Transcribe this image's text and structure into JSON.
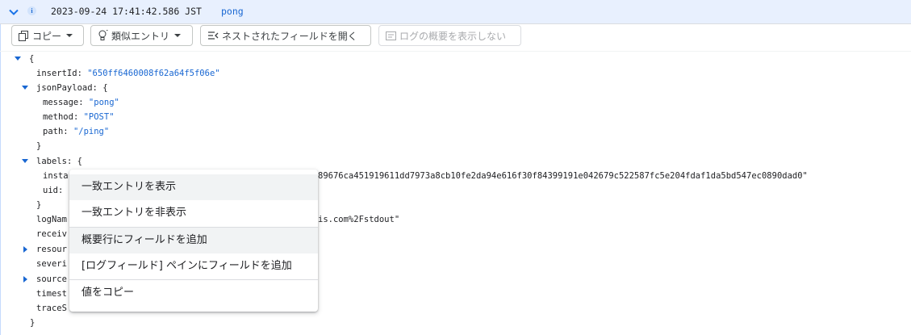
{
  "header": {
    "timestamp": "2023-09-24 17:41:42.586 JST",
    "summary": "pong",
    "severity_icon": "i"
  },
  "toolbar": {
    "copy_label": "コピー",
    "similar_label": "類似エントリ",
    "expand_label": "ネストされたフィールドを開く",
    "hide_summary_label": "ログの概要を表示しない"
  },
  "tree": {
    "open_brace": "{",
    "close_brace": "}",
    "insertId_key": "insertId",
    "insertId_value": "\"650ff6460008f62a64f5f06e\"",
    "jsonPayload_key": "jsonPayload",
    "message_key": "message",
    "message_value": "\"pong\"",
    "method_key": "method",
    "method_value": "\"POST\"",
    "path_key": "path",
    "path_value": "\"/ping\"",
    "labels_key": "labels",
    "instance_key_partial": "insta",
    "instance_value_partial": "89676ca451919611dd7973a8cb10fe2da94e616f30f84399191e042679c522587fc5e204fdaf1da5bd547ec0890dad0\"",
    "uid_key": "uid:",
    "logName_key_partial": "logNam",
    "logName_value_partial": "is.com%2Fstdout\"",
    "receive_key_partial": "receiv",
    "resource_key_partial": "resour",
    "severity_key_partial": "severi",
    "source_key_partial": "source",
    "timestamp_key_partial": "timest",
    "trace_key_partial": "traceS"
  },
  "context_menu": {
    "items": [
      "一致エントリを表示",
      "一致エントリを非表示",
      "概要行にフィールドを追加",
      "[ログフィールド] ペインにフィールドを追加",
      "値をコピー"
    ]
  },
  "colors": {
    "accent": "#1a73e8",
    "header_bg": "#e8f0fe",
    "string_value": "#1967d2"
  }
}
